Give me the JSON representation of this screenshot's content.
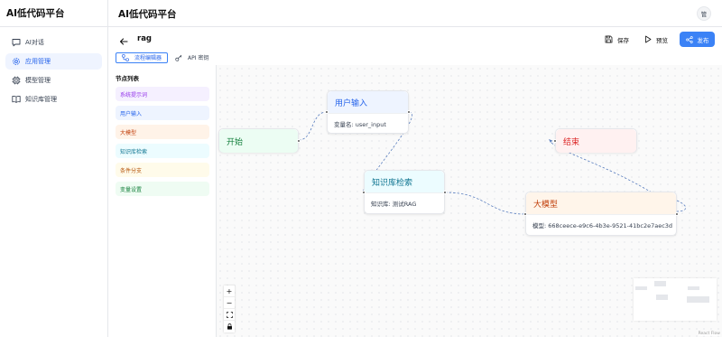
{
  "brand": "AI低代码平台",
  "sidebar": {
    "items": [
      {
        "label": "AI对话",
        "icon": "chat-icon",
        "active": false
      },
      {
        "label": "应用管理",
        "icon": "app-gear-icon",
        "active": true
      },
      {
        "label": "模型管理",
        "icon": "chip-icon",
        "active": false
      },
      {
        "label": "知识库管理",
        "icon": "book-icon",
        "active": false
      }
    ]
  },
  "header": {
    "title": "AI低代码平台",
    "avatar": "管"
  },
  "toolbar": {
    "flow_name": "rag",
    "save_label": "保存",
    "preview_label": "预览",
    "publish_label": "发布"
  },
  "tabs": [
    {
      "label": "流程编辑器",
      "icon": "flow-icon",
      "active": true
    },
    {
      "label": "API 密钥",
      "icon": "key-icon",
      "active": false
    }
  ],
  "palette": {
    "title": "节点列表",
    "items": [
      {
        "label": "系统提示词",
        "color": "#9333ea",
        "bg": "#f5f0ff"
      },
      {
        "label": "用户输入",
        "color": "#2563eb",
        "bg": "#eef4ff"
      },
      {
        "label": "大模型",
        "color": "#c2410c",
        "bg": "#fff3e8"
      },
      {
        "label": "知识库检索",
        "color": "#0e7490",
        "bg": "#ecfcff"
      },
      {
        "label": "条件分支",
        "color": "#b45309",
        "bg": "#fffbea"
      },
      {
        "label": "变量设置",
        "color": "#15803d",
        "bg": "#effcf3"
      }
    ]
  },
  "nodes": {
    "start": {
      "title": "开始",
      "color": "#15803d",
      "bg": "#ecfdf3"
    },
    "user_input": {
      "title": "用户输入",
      "body": "变量名: user_input",
      "color": "#2563eb",
      "bg": "#eef4ff"
    },
    "knowledge": {
      "title": "知识库检索",
      "body": "知识库: 测试RAG",
      "color": "#0e7490",
      "bg": "#ecfcff"
    },
    "end": {
      "title": "结束",
      "color": "#dc2626",
      "bg": "#fff1f1"
    },
    "llm": {
      "title": "大模型",
      "body": "模型: 668ceece-e9c6-4b3e-9521-41bc2e7aec3d",
      "color": "#c2410c",
      "bg": "#fff5ea"
    }
  },
  "controls": {
    "zoom_in": "+",
    "zoom_out": "−"
  },
  "attribution": "React Flow"
}
